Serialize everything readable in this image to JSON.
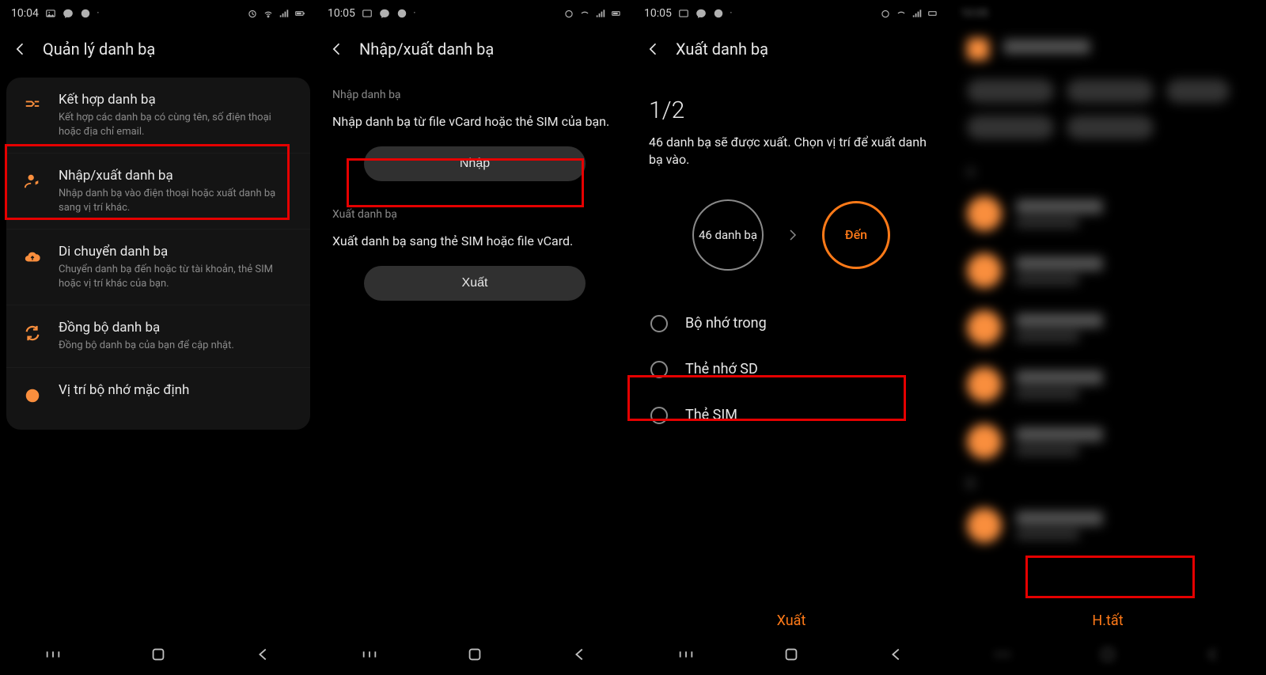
{
  "status_time": {
    "s1": "10:04",
    "s2": "10:05",
    "s3": "10:05",
    "s4": "10:05"
  },
  "screen1": {
    "title": "Quản lý danh bạ",
    "items": [
      {
        "title": "Kết hợp danh bạ",
        "sub": "Kết hợp các danh bạ có cùng tên, số điện thoại hoặc địa chỉ email."
      },
      {
        "title": "Nhập/xuất danh bạ",
        "sub": "Nhập danh bạ vào điện thoại hoặc xuất danh bạ sang vị trí khác."
      },
      {
        "title": "Di chuyển danh bạ",
        "sub": "Chuyển danh bạ đến hoặc từ tài khoản, thẻ SIM hoặc vị trí khác của bạn."
      },
      {
        "title": "Đồng bộ danh bạ",
        "sub": "Đồng bộ danh bạ của bạn để cập nhật."
      },
      {
        "title": "Vị trí bộ nhớ mặc định",
        "sub": ""
      }
    ]
  },
  "screen2": {
    "title": "Nhập/xuất danh bạ",
    "import_label": "Nhập danh bạ",
    "import_desc": "Nhập danh bạ từ file vCard hoặc thẻ SIM của bạn.",
    "import_btn": "Nhập",
    "export_label": "Xuất danh bạ",
    "export_desc": "Xuất danh bạ sang thẻ SIM hoặc file vCard.",
    "export_btn": "Xuất"
  },
  "screen3": {
    "title": "Xuất danh bạ",
    "progress": "1/2",
    "desc": "46 danh bạ sẽ được xuất. Chọn vị trí để xuất danh bạ vào.",
    "circle_source": "46 danh bạ",
    "circle_dest": "Đến",
    "options": [
      "Bộ nhớ trong",
      "Thẻ nhớ SD",
      "Thẻ SIM"
    ],
    "action": "Xuất"
  },
  "screen4": {
    "done": "H.tất",
    "section1": "A",
    "section2": "B"
  }
}
